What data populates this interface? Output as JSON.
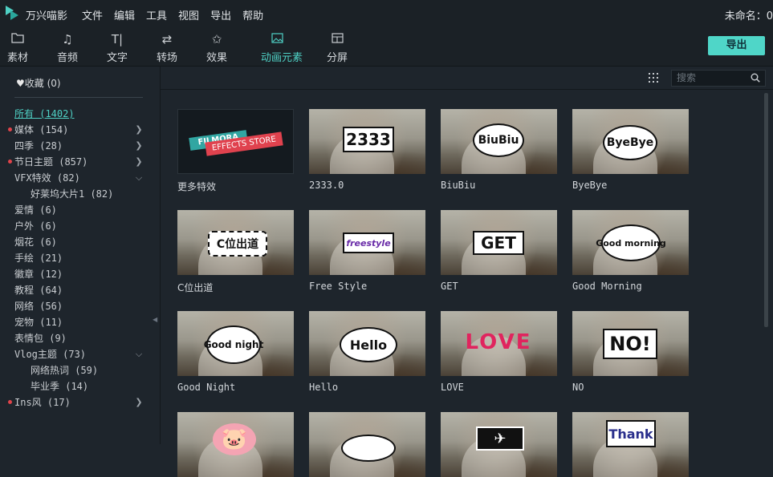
{
  "titlebar": {
    "app_name": "万兴喵影",
    "menu": [
      "文件",
      "编辑",
      "工具",
      "视图",
      "导出",
      "帮助"
    ],
    "doc_title": "未命名：0"
  },
  "toolbar": {
    "tabs": [
      {
        "label": "素材",
        "icon": "folder-icon"
      },
      {
        "label": "音频",
        "icon": "music-note-icon"
      },
      {
        "label": "文字",
        "icon": "text-icon"
      },
      {
        "label": "转场",
        "icon": "transition-icon"
      },
      {
        "label": "效果",
        "icon": "effects-icon"
      },
      {
        "label": "动画元素",
        "icon": "image-icon"
      },
      {
        "label": "分屏",
        "icon": "split-screen-icon"
      }
    ],
    "active_tab": "动画元素",
    "export_label": "导出"
  },
  "sidebar": {
    "favorites_label": "收藏 (0)",
    "categories": [
      {
        "label": "所有 (1402)",
        "active": true,
        "dot": false,
        "chevron": ""
      },
      {
        "label": "媒体 (154)",
        "dot": true,
        "chevron": "right"
      },
      {
        "label": "四季 (28)",
        "dot": false,
        "chevron": "right"
      },
      {
        "label": "节日主题 (857)",
        "dot": true,
        "chevron": "right"
      },
      {
        "label": "VFX特效 (82)",
        "dot": false,
        "chevron": "down"
      },
      {
        "label": "好莱坞大片1 (82)",
        "sub": true
      },
      {
        "label": "爱情 (6)"
      },
      {
        "label": "户外 (6)"
      },
      {
        "label": "烟花 (6)"
      },
      {
        "label": "手绘 (21)"
      },
      {
        "label": "徽章 (12)"
      },
      {
        "label": "教程 (64)"
      },
      {
        "label": "网络 (56)"
      },
      {
        "label": "宠物 (11)"
      },
      {
        "label": "表情包 (9)"
      },
      {
        "label": "Vlog主题 (73)",
        "chevron": "down"
      },
      {
        "label": "网络热词 (59)",
        "sub": true
      },
      {
        "label": "毕业季 (14)",
        "sub": true
      },
      {
        "label": "Ins风 (17)",
        "dot": true,
        "chevron": "right"
      }
    ]
  },
  "search": {
    "placeholder": "搜索"
  },
  "store": {
    "label": "更多特效",
    "banner1": "FILMORA",
    "banner2": "EFFECTS STORE"
  },
  "elements": [
    {
      "label": "2333.0",
      "sticker": "2333"
    },
    {
      "label": "BiuBiu",
      "sticker": "BiuBiu"
    },
    {
      "label": "ByeBye",
      "sticker": "ByeBye"
    },
    {
      "label": "C位出道",
      "sticker": "C位出道"
    },
    {
      "label": "Free Style",
      "sticker": "freestyle"
    },
    {
      "label": "GET",
      "sticker": "GET"
    },
    {
      "label": "Good Morning",
      "sticker": "Good morning"
    },
    {
      "label": "Good Night",
      "sticker": "Good night"
    },
    {
      "label": "Hello",
      "sticker": "Hello"
    },
    {
      "label": "LOVE",
      "sticker": "LOVE"
    },
    {
      "label": "NO",
      "sticker": "NO!"
    },
    {
      "label": "",
      "sticker": "🐷"
    },
    {
      "label": "",
      "sticker": ""
    },
    {
      "label": "",
      "sticker": "✈"
    },
    {
      "label": "",
      "sticker": "Thank"
    }
  ],
  "colors": {
    "accent": "#4fd1c5",
    "background": "#1e252c",
    "badge_dot": "#e0434a"
  }
}
